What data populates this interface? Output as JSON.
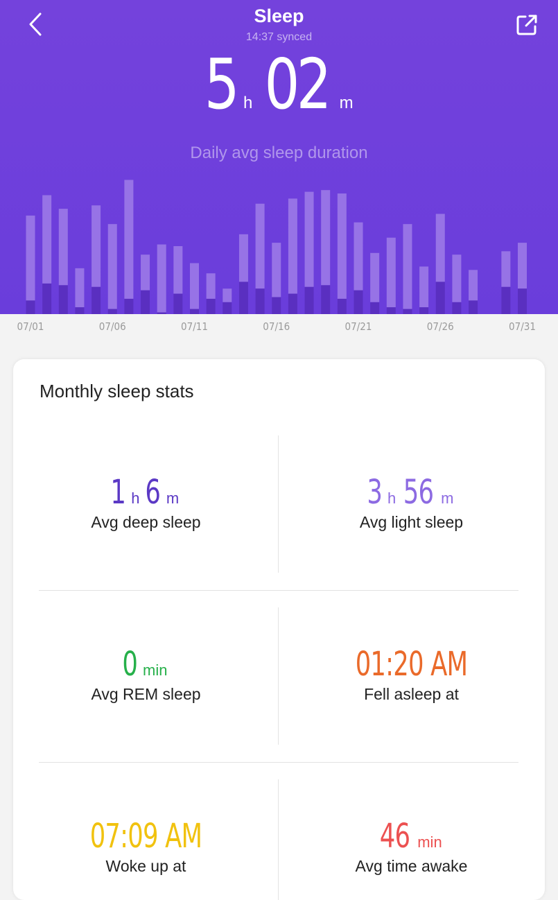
{
  "header": {
    "title": "Sleep",
    "sync_status": "14:37 synced",
    "duration_hours": "5",
    "hours_unit": "h",
    "duration_minutes": "02",
    "minutes_unit": "m",
    "caption": "Daily avg sleep duration",
    "back_icon": "chevron-left-icon",
    "share_icon": "share-icon",
    "background_color": "#7442dc"
  },
  "chart_data": {
    "type": "bar",
    "stacked": true,
    "x_tick_labels": [
      "07/01",
      "07/06",
      "07/11",
      "07/16",
      "07/21",
      "07/26",
      "07/31"
    ],
    "categories": [
      "07/01",
      "07/02",
      "07/03",
      "07/04",
      "07/05",
      "07/06",
      "07/07",
      "07/08",
      "07/09",
      "07/10",
      "07/11",
      "07/12",
      "07/13",
      "07/14",
      "07/15",
      "07/16",
      "07/17",
      "07/18",
      "07/19",
      "07/20",
      "07/21",
      "07/22",
      "07/23",
      "07/24",
      "07/25",
      "07/26",
      "07/27",
      "07/28",
      "07/29",
      "07/30",
      "07/31"
    ],
    "series": [
      {
        "values": [
          0.8,
          1.8,
          1.7,
          0.4,
          1.6,
          0.3,
          0.9,
          1.4,
          0.1,
          1.2,
          0.3,
          0.9,
          0.7,
          1.9,
          1.5,
          1.0,
          1.2,
          1.6,
          1.7,
          0.9,
          1.4,
          0.7,
          0.4,
          0.3,
          0.4,
          1.9,
          0.7,
          0.8,
          0,
          1.6,
          1.5
        ],
        "color": "#5a2fc0"
      },
      {
        "values": [
          5.0,
          5.2,
          4.5,
          2.3,
          4.8,
          5.0,
          7.0,
          2.1,
          4.0,
          2.8,
          2.7,
          1.5,
          0.8,
          2.8,
          5.0,
          3.2,
          5.6,
          5.6,
          5.6,
          6.2,
          4.0,
          2.9,
          4.1,
          5.0,
          2.4,
          4.0,
          2.8,
          1.8,
          0,
          2.1,
          2.7
        ],
        "color": "#9773e6"
      }
    ],
    "colors": {
      "deep": "#5a2fc0",
      "light": "#9773e6"
    }
  },
  "stats": {
    "title": "Monthly sleep stats",
    "deep": {
      "hours": "1",
      "h_unit": "h",
      "minutes": "6",
      "m_unit": "m",
      "label": "Avg deep sleep",
      "color": "#5b39c5"
    },
    "light": {
      "hours": "3",
      "h_unit": "h",
      "minutes": "56",
      "m_unit": "m",
      "label": "Avg light sleep",
      "color": "#8c6ae2"
    },
    "rem": {
      "value": "0",
      "unit": "min",
      "label": "Avg REM sleep",
      "color": "#26b04a"
    },
    "fell_asleep": {
      "value": "01:20 AM",
      "label": "Fell asleep at",
      "color": "#ea6a2a"
    },
    "woke_up": {
      "value": "07:09 AM",
      "label": "Woke up at",
      "color": "#f1c20f"
    },
    "awake": {
      "value": "46",
      "unit": "min",
      "label": "Avg time awake",
      "color": "#ec5151"
    }
  }
}
